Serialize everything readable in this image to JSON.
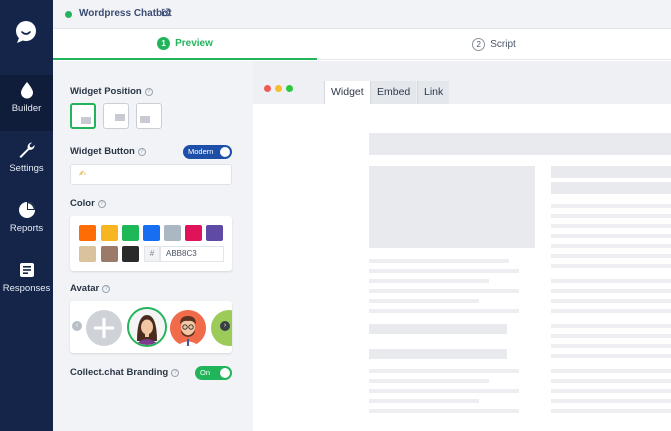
{
  "nav": {
    "items": [
      {
        "label": "Builder",
        "icon": "droplet-icon"
      },
      {
        "label": "Settings",
        "icon": "wrench-icon"
      },
      {
        "label": "Reports",
        "icon": "pie-chart-icon"
      },
      {
        "label": "Responses",
        "icon": "list-icon"
      }
    ]
  },
  "topbar": {
    "bot_name": "Wordpress Chatbot",
    "status": "online"
  },
  "tabs": [
    {
      "num": "1",
      "label": "Preview",
      "active": true
    },
    {
      "num": "2",
      "label": "Script",
      "active": false
    }
  ],
  "settings": {
    "widget_position": {
      "title": "Widget Position",
      "selected": "bottom-left"
    },
    "widget_button": {
      "title": "Widget Button",
      "toggle_label": "Modern",
      "toggle_on": true,
      "emoji": "✍"
    },
    "color": {
      "title": "Color",
      "swatches": [
        "#fe6c06",
        "#f8b522",
        "#1fb859",
        "#176ef1",
        "#abb8c3",
        "#e0135a",
        "#5f4aa5",
        "#d9c29c",
        "#9b7a6a",
        "#2a2a2a"
      ],
      "hash": "#",
      "hex_value": "ABB8C3"
    },
    "avatar": {
      "title": "Avatar"
    },
    "branding": {
      "title": "Collect.chat Branding",
      "toggle_label": "On",
      "toggle_on": true
    }
  },
  "preview": {
    "tabs": [
      {
        "label": "Widget",
        "active": true
      },
      {
        "label": "Embed",
        "active": false
      },
      {
        "label": "Link",
        "active": false
      }
    ],
    "window_dots": [
      "#ef5b58",
      "#f7bd2f",
      "#2bc840"
    ]
  },
  "colors": {
    "nav_bg": "#15254a",
    "accent": "#22b45a",
    "toggle_blue": "#1e4fa8"
  }
}
